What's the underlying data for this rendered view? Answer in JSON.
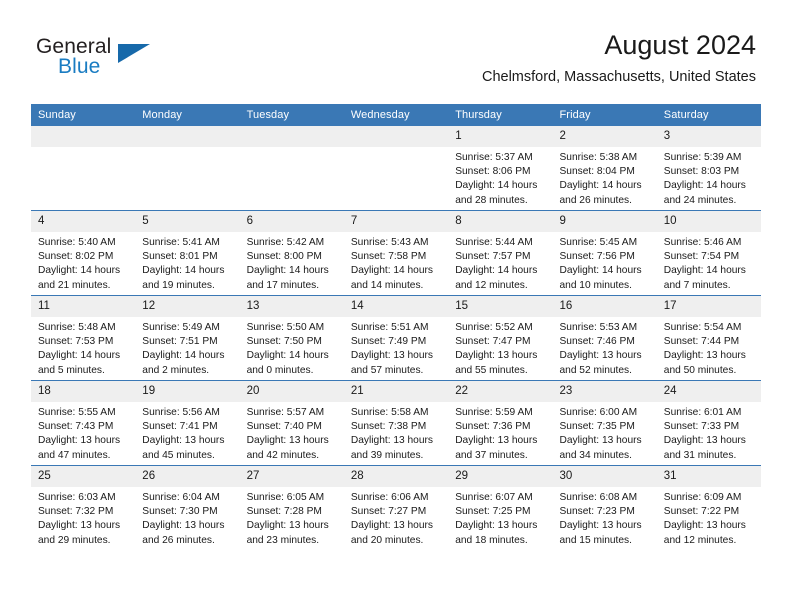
{
  "brand": {
    "name_part1": "General",
    "name_part2": "Blue",
    "triangle_color": "#1769aa",
    "blue_text_color": "#1a7cc2"
  },
  "header": {
    "title": "August 2024",
    "subtitle": "Chelmsford, Massachusetts, United States"
  },
  "theme": {
    "header_blue": "#3a78b5",
    "row_rule_blue": "#3a78b5",
    "daynum_band": "#efefef",
    "page_background": "#ffffff"
  },
  "weekdays": [
    "Sunday",
    "Monday",
    "Tuesday",
    "Wednesday",
    "Thursday",
    "Friday",
    "Saturday"
  ],
  "weeks": [
    [
      {
        "day": "",
        "empty": true,
        "sunrise": "",
        "sunset": "",
        "daylight": ""
      },
      {
        "day": "",
        "empty": true,
        "sunrise": "",
        "sunset": "",
        "daylight": ""
      },
      {
        "day": "",
        "empty": true,
        "sunrise": "",
        "sunset": "",
        "daylight": ""
      },
      {
        "day": "",
        "empty": true,
        "sunrise": "",
        "sunset": "",
        "daylight": ""
      },
      {
        "day": "1",
        "empty": false,
        "sunrise": "Sunrise: 5:37 AM",
        "sunset": "Sunset: 8:06 PM",
        "daylight": "Daylight: 14 hours and 28 minutes."
      },
      {
        "day": "2",
        "empty": false,
        "sunrise": "Sunrise: 5:38 AM",
        "sunset": "Sunset: 8:04 PM",
        "daylight": "Daylight: 14 hours and 26 minutes."
      },
      {
        "day": "3",
        "empty": false,
        "sunrise": "Sunrise: 5:39 AM",
        "sunset": "Sunset: 8:03 PM",
        "daylight": "Daylight: 14 hours and 24 minutes."
      }
    ],
    [
      {
        "day": "4",
        "empty": false,
        "sunrise": "Sunrise: 5:40 AM",
        "sunset": "Sunset: 8:02 PM",
        "daylight": "Daylight: 14 hours and 21 minutes."
      },
      {
        "day": "5",
        "empty": false,
        "sunrise": "Sunrise: 5:41 AM",
        "sunset": "Sunset: 8:01 PM",
        "daylight": "Daylight: 14 hours and 19 minutes."
      },
      {
        "day": "6",
        "empty": false,
        "sunrise": "Sunrise: 5:42 AM",
        "sunset": "Sunset: 8:00 PM",
        "daylight": "Daylight: 14 hours and 17 minutes."
      },
      {
        "day": "7",
        "empty": false,
        "sunrise": "Sunrise: 5:43 AM",
        "sunset": "Sunset: 7:58 PM",
        "daylight": "Daylight: 14 hours and 14 minutes."
      },
      {
        "day": "8",
        "empty": false,
        "sunrise": "Sunrise: 5:44 AM",
        "sunset": "Sunset: 7:57 PM",
        "daylight": "Daylight: 14 hours and 12 minutes."
      },
      {
        "day": "9",
        "empty": false,
        "sunrise": "Sunrise: 5:45 AM",
        "sunset": "Sunset: 7:56 PM",
        "daylight": "Daylight: 14 hours and 10 minutes."
      },
      {
        "day": "10",
        "empty": false,
        "sunrise": "Sunrise: 5:46 AM",
        "sunset": "Sunset: 7:54 PM",
        "daylight": "Daylight: 14 hours and 7 minutes."
      }
    ],
    [
      {
        "day": "11",
        "empty": false,
        "sunrise": "Sunrise: 5:48 AM",
        "sunset": "Sunset: 7:53 PM",
        "daylight": "Daylight: 14 hours and 5 minutes."
      },
      {
        "day": "12",
        "empty": false,
        "sunrise": "Sunrise: 5:49 AM",
        "sunset": "Sunset: 7:51 PM",
        "daylight": "Daylight: 14 hours and 2 minutes."
      },
      {
        "day": "13",
        "empty": false,
        "sunrise": "Sunrise: 5:50 AM",
        "sunset": "Sunset: 7:50 PM",
        "daylight": "Daylight: 14 hours and 0 minutes."
      },
      {
        "day": "14",
        "empty": false,
        "sunrise": "Sunrise: 5:51 AM",
        "sunset": "Sunset: 7:49 PM",
        "daylight": "Daylight: 13 hours and 57 minutes."
      },
      {
        "day": "15",
        "empty": false,
        "sunrise": "Sunrise: 5:52 AM",
        "sunset": "Sunset: 7:47 PM",
        "daylight": "Daylight: 13 hours and 55 minutes."
      },
      {
        "day": "16",
        "empty": false,
        "sunrise": "Sunrise: 5:53 AM",
        "sunset": "Sunset: 7:46 PM",
        "daylight": "Daylight: 13 hours and 52 minutes."
      },
      {
        "day": "17",
        "empty": false,
        "sunrise": "Sunrise: 5:54 AM",
        "sunset": "Sunset: 7:44 PM",
        "daylight": "Daylight: 13 hours and 50 minutes."
      }
    ],
    [
      {
        "day": "18",
        "empty": false,
        "sunrise": "Sunrise: 5:55 AM",
        "sunset": "Sunset: 7:43 PM",
        "daylight": "Daylight: 13 hours and 47 minutes."
      },
      {
        "day": "19",
        "empty": false,
        "sunrise": "Sunrise: 5:56 AM",
        "sunset": "Sunset: 7:41 PM",
        "daylight": "Daylight: 13 hours and 45 minutes."
      },
      {
        "day": "20",
        "empty": false,
        "sunrise": "Sunrise: 5:57 AM",
        "sunset": "Sunset: 7:40 PM",
        "daylight": "Daylight: 13 hours and 42 minutes."
      },
      {
        "day": "21",
        "empty": false,
        "sunrise": "Sunrise: 5:58 AM",
        "sunset": "Sunset: 7:38 PM",
        "daylight": "Daylight: 13 hours and 39 minutes."
      },
      {
        "day": "22",
        "empty": false,
        "sunrise": "Sunrise: 5:59 AM",
        "sunset": "Sunset: 7:36 PM",
        "daylight": "Daylight: 13 hours and 37 minutes."
      },
      {
        "day": "23",
        "empty": false,
        "sunrise": "Sunrise: 6:00 AM",
        "sunset": "Sunset: 7:35 PM",
        "daylight": "Daylight: 13 hours and 34 minutes."
      },
      {
        "day": "24",
        "empty": false,
        "sunrise": "Sunrise: 6:01 AM",
        "sunset": "Sunset: 7:33 PM",
        "daylight": "Daylight: 13 hours and 31 minutes."
      }
    ],
    [
      {
        "day": "25",
        "empty": false,
        "sunrise": "Sunrise: 6:03 AM",
        "sunset": "Sunset: 7:32 PM",
        "daylight": "Daylight: 13 hours and 29 minutes."
      },
      {
        "day": "26",
        "empty": false,
        "sunrise": "Sunrise: 6:04 AM",
        "sunset": "Sunset: 7:30 PM",
        "daylight": "Daylight: 13 hours and 26 minutes."
      },
      {
        "day": "27",
        "empty": false,
        "sunrise": "Sunrise: 6:05 AM",
        "sunset": "Sunset: 7:28 PM",
        "daylight": "Daylight: 13 hours and 23 minutes."
      },
      {
        "day": "28",
        "empty": false,
        "sunrise": "Sunrise: 6:06 AM",
        "sunset": "Sunset: 7:27 PM",
        "daylight": "Daylight: 13 hours and 20 minutes."
      },
      {
        "day": "29",
        "empty": false,
        "sunrise": "Sunrise: 6:07 AM",
        "sunset": "Sunset: 7:25 PM",
        "daylight": "Daylight: 13 hours and 18 minutes."
      },
      {
        "day": "30",
        "empty": false,
        "sunrise": "Sunrise: 6:08 AM",
        "sunset": "Sunset: 7:23 PM",
        "daylight": "Daylight: 13 hours and 15 minutes."
      },
      {
        "day": "31",
        "empty": false,
        "sunrise": "Sunrise: 6:09 AM",
        "sunset": "Sunset: 7:22 PM",
        "daylight": "Daylight: 13 hours and 12 minutes."
      }
    ]
  ]
}
